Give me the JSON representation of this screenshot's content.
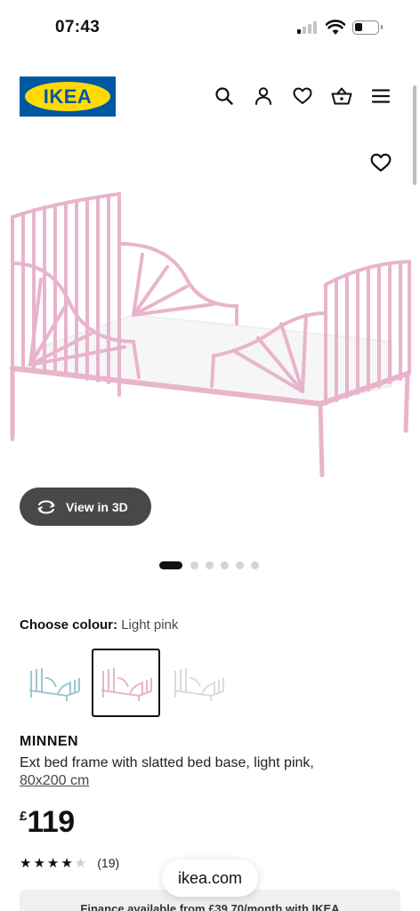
{
  "status": {
    "time": "07:43",
    "battery_level": 0.3
  },
  "header": {
    "logo_text": "IKEA",
    "brand_colors": {
      "blue": "#0058a3",
      "yellow": "#ffdb00"
    },
    "icons": [
      "search-icon",
      "account-icon",
      "wishlist-icon",
      "basket-icon",
      "menu-icon"
    ]
  },
  "product_image": {
    "view_3d_label": "View in 3D",
    "slide_count": 6,
    "active_slide": 1
  },
  "colour": {
    "label": "Choose colour:",
    "selected": "Light pink",
    "swatches": [
      "light turquoise",
      "light pink",
      "white"
    ],
    "selected_index": 1
  },
  "product": {
    "name": "MINNEN",
    "description": "Ext bed frame with slatted bed base, light pink,",
    "size": "80x200 cm",
    "currency": "£",
    "price": "119",
    "rating_value": 4.5,
    "review_count": "(19)"
  },
  "browser": {
    "url": "ikea.com"
  },
  "finance": {
    "text": "Finance available from £39.70/month with IKEA"
  }
}
